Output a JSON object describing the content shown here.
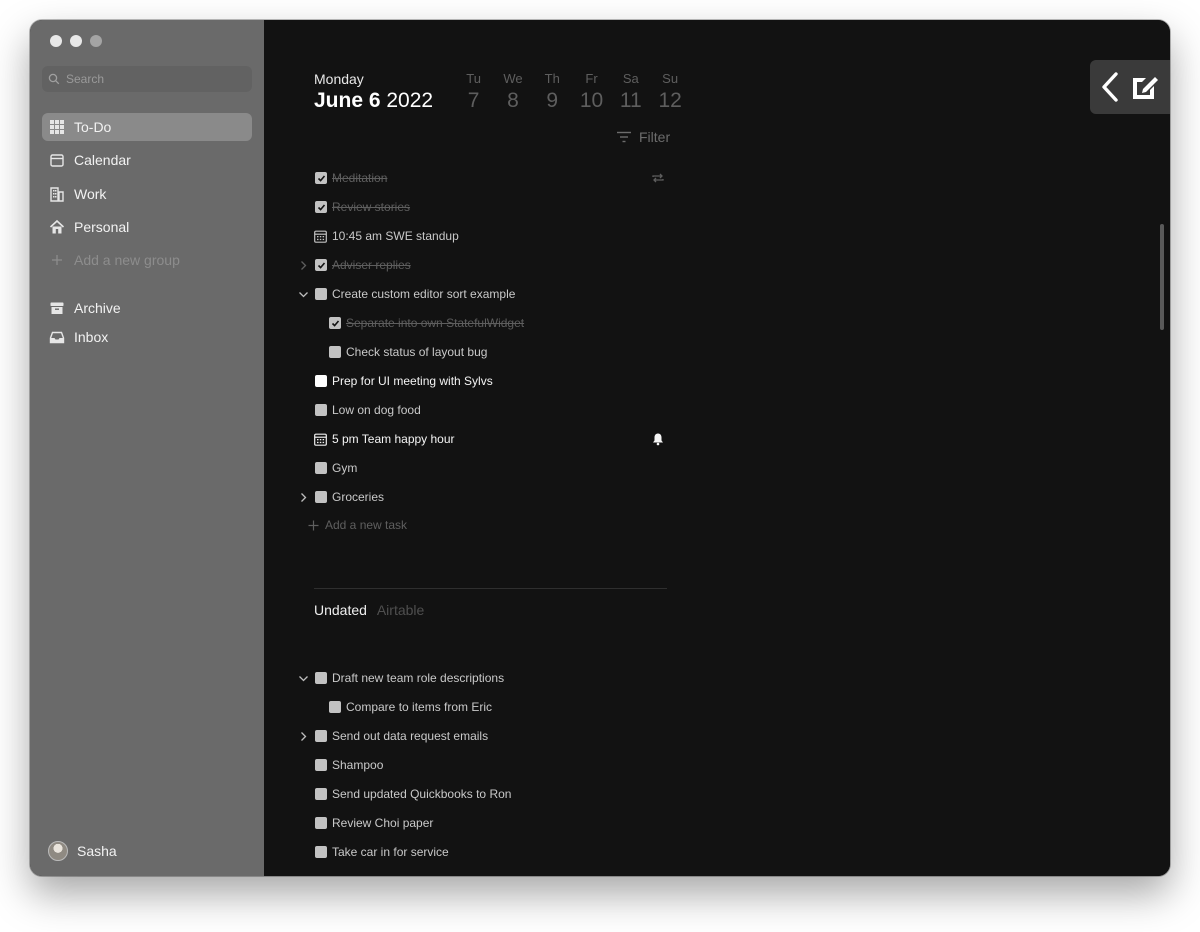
{
  "sidebar": {
    "search_placeholder": "Search",
    "items": [
      {
        "label": "To-Do",
        "icon": "grid-icon",
        "active": true
      },
      {
        "label": "Calendar",
        "icon": "calendar-icon"
      },
      {
        "label": "Work",
        "icon": "building-icon"
      },
      {
        "label": "Personal",
        "icon": "house-icon"
      },
      {
        "label": "Add a new group",
        "icon": "plus-icon"
      },
      {
        "label": "Archive",
        "icon": "archive-icon"
      },
      {
        "label": "Inbox",
        "icon": "inbox-icon"
      }
    ],
    "user": "Sasha"
  },
  "header": {
    "weekday": "Monday",
    "month_day": "June 6",
    "year": "2022",
    "week": [
      {
        "abbr": "Tu",
        "num": "7"
      },
      {
        "abbr": "We",
        "num": "8"
      },
      {
        "abbr": "Th",
        "num": "9"
      },
      {
        "abbr": "Fr",
        "num": "10"
      },
      {
        "abbr": "Sa",
        "num": "11"
      },
      {
        "abbr": "Su",
        "num": "12"
      }
    ],
    "filter_label": "Filter"
  },
  "today_tasks": [
    {
      "label": "Meditation",
      "done": true,
      "icon": "repeat-icon"
    },
    {
      "label": "Review stories",
      "done": true
    },
    {
      "label": "10:45 am SWE standup",
      "type": "event"
    },
    {
      "label": "Adviser replies",
      "done": true,
      "chevron": "right"
    },
    {
      "label": "Create custom editor sort example",
      "chevron": "down"
    },
    {
      "label": "Separate into own StatefulWidget",
      "done": true,
      "indent": true
    },
    {
      "label": "Check status of layout bug",
      "indent": true
    },
    {
      "label": "Prep for UI meeting with Sylvs",
      "bright": true
    },
    {
      "label": "Low on dog food"
    },
    {
      "label": "5 pm Team happy hour",
      "type": "event",
      "bright": true,
      "icon": "bell-icon"
    },
    {
      "label": "Gym"
    },
    {
      "label": "Groceries",
      "chevron": "right"
    }
  ],
  "add_task_label": "Add a new task",
  "undated": {
    "title": "Undated",
    "subtitle": "Airtable",
    "tasks": [
      {
        "label": "Draft new team role descriptions",
        "chevron": "down"
      },
      {
        "label": "Compare to items from Eric",
        "indent": true
      },
      {
        "label": "Send out data request emails",
        "chevron": "right"
      },
      {
        "label": "Shampoo"
      },
      {
        "label": "Send updated Quickbooks to Ron"
      },
      {
        "label": "Review Choi paper"
      },
      {
        "label": "Take car in for service"
      }
    ]
  }
}
